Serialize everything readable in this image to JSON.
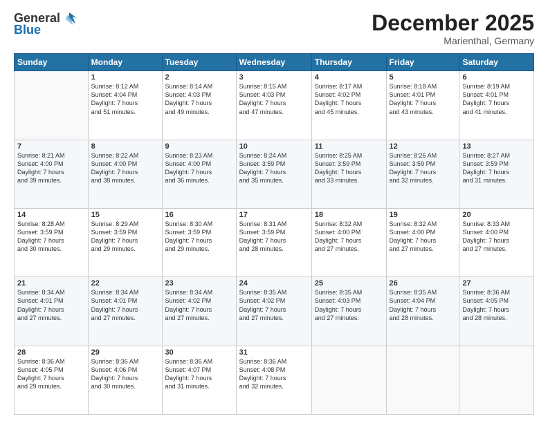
{
  "header": {
    "logo_general": "General",
    "logo_blue": "Blue",
    "month_title": "December 2025",
    "subtitle": "Marienthal, Germany"
  },
  "weekdays": [
    "Sunday",
    "Monday",
    "Tuesday",
    "Wednesday",
    "Thursday",
    "Friday",
    "Saturday"
  ],
  "weeks": [
    [
      {
        "day": "",
        "info": ""
      },
      {
        "day": "1",
        "info": "Sunrise: 8:12 AM\nSunset: 4:04 PM\nDaylight: 7 hours\nand 51 minutes."
      },
      {
        "day": "2",
        "info": "Sunrise: 8:14 AM\nSunset: 4:03 PM\nDaylight: 7 hours\nand 49 minutes."
      },
      {
        "day": "3",
        "info": "Sunrise: 8:15 AM\nSunset: 4:03 PM\nDaylight: 7 hours\nand 47 minutes."
      },
      {
        "day": "4",
        "info": "Sunrise: 8:17 AM\nSunset: 4:02 PM\nDaylight: 7 hours\nand 45 minutes."
      },
      {
        "day": "5",
        "info": "Sunrise: 8:18 AM\nSunset: 4:01 PM\nDaylight: 7 hours\nand 43 minutes."
      },
      {
        "day": "6",
        "info": "Sunrise: 8:19 AM\nSunset: 4:01 PM\nDaylight: 7 hours\nand 41 minutes."
      }
    ],
    [
      {
        "day": "7",
        "info": "Sunrise: 8:21 AM\nSunset: 4:00 PM\nDaylight: 7 hours\nand 39 minutes."
      },
      {
        "day": "8",
        "info": "Sunrise: 8:22 AM\nSunset: 4:00 PM\nDaylight: 7 hours\nand 38 minutes."
      },
      {
        "day": "9",
        "info": "Sunrise: 8:23 AM\nSunset: 4:00 PM\nDaylight: 7 hours\nand 36 minutes."
      },
      {
        "day": "10",
        "info": "Sunrise: 8:24 AM\nSunset: 3:59 PM\nDaylight: 7 hours\nand 35 minutes."
      },
      {
        "day": "11",
        "info": "Sunrise: 8:25 AM\nSunset: 3:59 PM\nDaylight: 7 hours\nand 33 minutes."
      },
      {
        "day": "12",
        "info": "Sunrise: 8:26 AM\nSunset: 3:59 PM\nDaylight: 7 hours\nand 32 minutes."
      },
      {
        "day": "13",
        "info": "Sunrise: 8:27 AM\nSunset: 3:59 PM\nDaylight: 7 hours\nand 31 minutes."
      }
    ],
    [
      {
        "day": "14",
        "info": "Sunrise: 8:28 AM\nSunset: 3:59 PM\nDaylight: 7 hours\nand 30 minutes."
      },
      {
        "day": "15",
        "info": "Sunrise: 8:29 AM\nSunset: 3:59 PM\nDaylight: 7 hours\nand 29 minutes."
      },
      {
        "day": "16",
        "info": "Sunrise: 8:30 AM\nSunset: 3:59 PM\nDaylight: 7 hours\nand 29 minutes."
      },
      {
        "day": "17",
        "info": "Sunrise: 8:31 AM\nSunset: 3:59 PM\nDaylight: 7 hours\nand 28 minutes."
      },
      {
        "day": "18",
        "info": "Sunrise: 8:32 AM\nSunset: 4:00 PM\nDaylight: 7 hours\nand 27 minutes."
      },
      {
        "day": "19",
        "info": "Sunrise: 8:32 AM\nSunset: 4:00 PM\nDaylight: 7 hours\nand 27 minutes."
      },
      {
        "day": "20",
        "info": "Sunrise: 8:33 AM\nSunset: 4:00 PM\nDaylight: 7 hours\nand 27 minutes."
      }
    ],
    [
      {
        "day": "21",
        "info": "Sunrise: 8:34 AM\nSunset: 4:01 PM\nDaylight: 7 hours\nand 27 minutes."
      },
      {
        "day": "22",
        "info": "Sunrise: 8:34 AM\nSunset: 4:01 PM\nDaylight: 7 hours\nand 27 minutes."
      },
      {
        "day": "23",
        "info": "Sunrise: 8:34 AM\nSunset: 4:02 PM\nDaylight: 7 hours\nand 27 minutes."
      },
      {
        "day": "24",
        "info": "Sunrise: 8:35 AM\nSunset: 4:02 PM\nDaylight: 7 hours\nand 27 minutes."
      },
      {
        "day": "25",
        "info": "Sunrise: 8:35 AM\nSunset: 4:03 PM\nDaylight: 7 hours\nand 27 minutes."
      },
      {
        "day": "26",
        "info": "Sunrise: 8:35 AM\nSunset: 4:04 PM\nDaylight: 7 hours\nand 28 minutes."
      },
      {
        "day": "27",
        "info": "Sunrise: 8:36 AM\nSunset: 4:05 PM\nDaylight: 7 hours\nand 28 minutes."
      }
    ],
    [
      {
        "day": "28",
        "info": "Sunrise: 8:36 AM\nSunset: 4:05 PM\nDaylight: 7 hours\nand 29 minutes."
      },
      {
        "day": "29",
        "info": "Sunrise: 8:36 AM\nSunset: 4:06 PM\nDaylight: 7 hours\nand 30 minutes."
      },
      {
        "day": "30",
        "info": "Sunrise: 8:36 AM\nSunset: 4:07 PM\nDaylight: 7 hours\nand 31 minutes."
      },
      {
        "day": "31",
        "info": "Sunrise: 8:36 AM\nSunset: 4:08 PM\nDaylight: 7 hours\nand 32 minutes."
      },
      {
        "day": "",
        "info": ""
      },
      {
        "day": "",
        "info": ""
      },
      {
        "day": "",
        "info": ""
      }
    ]
  ]
}
